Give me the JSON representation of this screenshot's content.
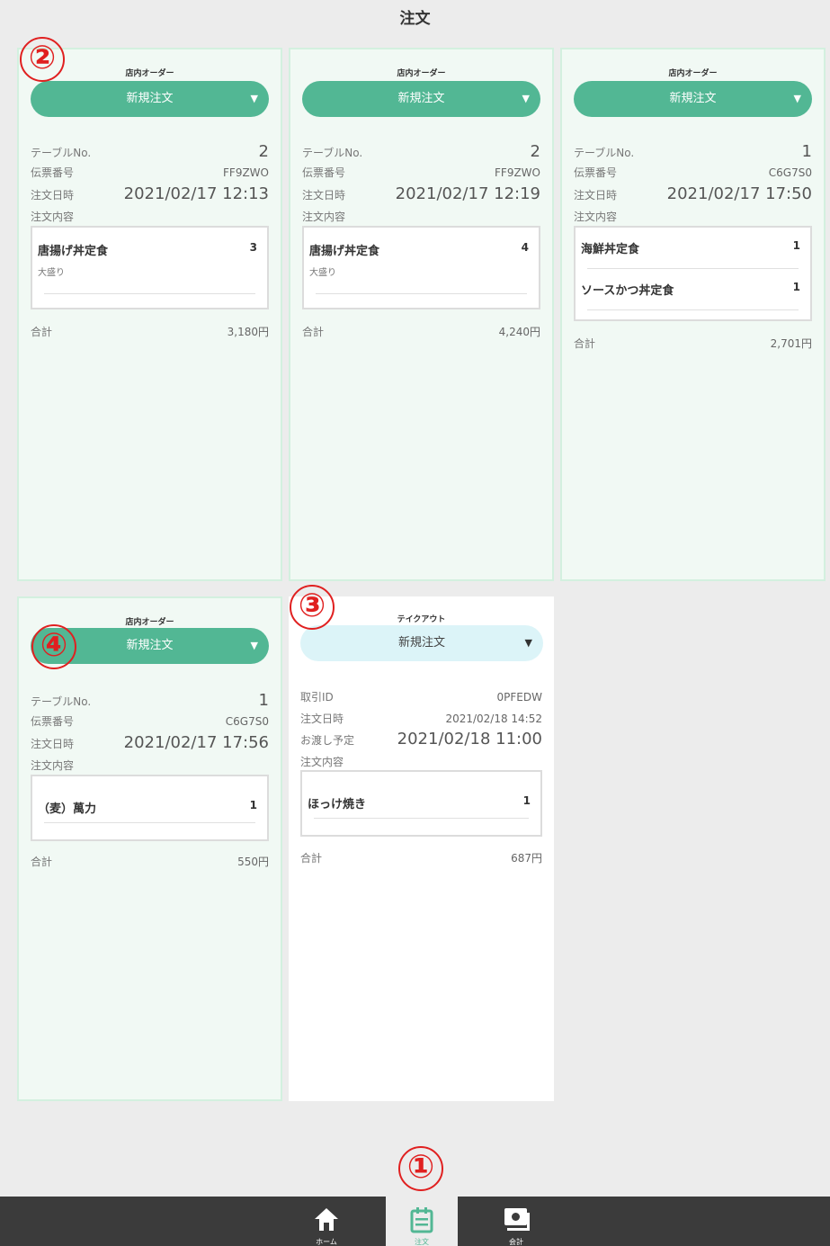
{
  "page_title": "注文",
  "orders": [
    {
      "type_label": "店内オーダー",
      "status": "新規注文",
      "fields": [
        {
          "label": "テーブルNo.",
          "value": "2"
        },
        {
          "label": "伝票番号",
          "value": "FF9ZWO"
        },
        {
          "label": "注文日時",
          "value": "2021/02/17 12:13"
        }
      ],
      "contents_label": "注文内容",
      "items": [
        {
          "name": "唐揚げ丼定食",
          "qty": "3",
          "option": "大盛り"
        }
      ],
      "total_label": "合計",
      "total": "3,180円"
    },
    {
      "type_label": "店内オーダー",
      "status": "新規注文",
      "fields": [
        {
          "label": "テーブルNo.",
          "value": "2"
        },
        {
          "label": "伝票番号",
          "value": "FF9ZWO"
        },
        {
          "label": "注文日時",
          "value": "2021/02/17 12:19"
        }
      ],
      "contents_label": "注文内容",
      "items": [
        {
          "name": "唐揚げ丼定食",
          "qty": "4",
          "option": "大盛り"
        }
      ],
      "total_label": "合計",
      "total": "4,240円"
    },
    {
      "type_label": "店内オーダー",
      "status": "新規注文",
      "fields": [
        {
          "label": "テーブルNo.",
          "value": "1"
        },
        {
          "label": "伝票番号",
          "value": "C6G7S0"
        },
        {
          "label": "注文日時",
          "value": "2021/02/17 17:50"
        }
      ],
      "contents_label": "注文内容",
      "items": [
        {
          "name": "海鮮丼定食",
          "qty": "1"
        },
        {
          "name": "ソースかつ丼定食",
          "qty": "1"
        }
      ],
      "total_label": "合計",
      "total": "2,701円"
    },
    {
      "type_label": "店内オーダー",
      "status": "新規注文",
      "fields": [
        {
          "label": "テーブルNo.",
          "value": "1"
        },
        {
          "label": "伝票番号",
          "value": "C6G7S0"
        },
        {
          "label": "注文日時",
          "value": "2021/02/17 17:56"
        }
      ],
      "contents_label": "注文内容",
      "items": [
        {
          "name": "（麦）萬力",
          "qty": "1"
        }
      ],
      "total_label": "合計",
      "total": "550円"
    },
    {
      "type_label": "テイクアウト",
      "status": "新規注文",
      "fields": [
        {
          "label": "取引ID",
          "value": "0PFEDW"
        },
        {
          "label": "注文日時",
          "value": "2021/02/18 14:52"
        },
        {
          "label": "お渡し予定",
          "value": "2021/02/18 11:00"
        }
      ],
      "contents_label": "注文内容",
      "items": [
        {
          "name": "ほっけ焼き",
          "qty": "1"
        }
      ],
      "total_label": "合計",
      "total": "687円"
    }
  ],
  "markers": [
    "①",
    "②",
    "③",
    "④"
  ],
  "bottom_nav": [
    {
      "label": "ホーム",
      "icon": "home-icon"
    },
    {
      "label": "注文",
      "icon": "order-icon",
      "active": true
    },
    {
      "label": "会計",
      "icon": "register-icon"
    }
  ],
  "colors": {
    "accent": "#52b794",
    "takeout_status_bg": "#dcf4f8",
    "marker": "#e02020",
    "nav_bg": "#3b3b3b"
  }
}
